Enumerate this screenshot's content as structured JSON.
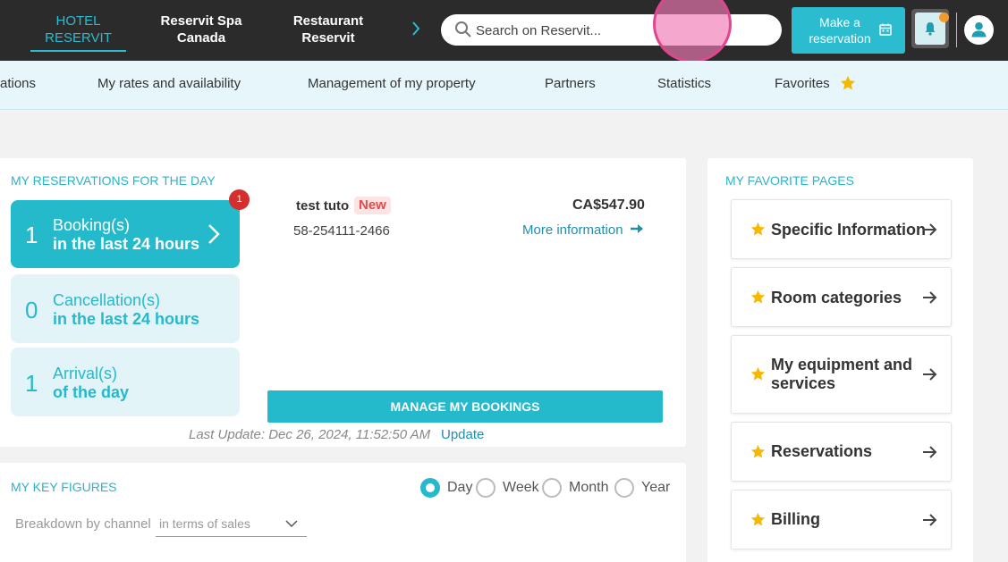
{
  "header": {
    "properties": [
      {
        "line1": "HOTEL",
        "line2": "RESERVIT"
      },
      {
        "line1": "Reservit Spa",
        "line2": "Canada"
      },
      {
        "line1": "Restaurant",
        "line2": "Reservit"
      }
    ],
    "search_placeholder": "Search on Reservit...",
    "make_reservation": {
      "line1": "Make a",
      "line2": "reservation"
    }
  },
  "nav": {
    "items": [
      "ations",
      "My rates and availability",
      "Management of my property",
      "Partners",
      "Statistics",
      "Favorites"
    ]
  },
  "reservations": {
    "title": "MY RESERVATIONS FOR THE DAY",
    "badge": "1",
    "tiles": [
      {
        "count": "1",
        "line1": "Booking(s)",
        "line2": "in the last 24 hours"
      },
      {
        "count": "0",
        "line1": "Cancellation(s)",
        "line2": "in the last 24 hours"
      },
      {
        "count": "1",
        "line1": "Arrival(s)",
        "line2": "of the day"
      }
    ],
    "entry": {
      "name": "test tuto",
      "tag": "New",
      "number": "58-254111-2466",
      "price": "CA$547.90",
      "more_info": "More information"
    },
    "manage_button": "MANAGE MY BOOKINGS",
    "last_update": "Last Update: Dec 26, 2024, 11:52:50 AM",
    "update_link": "Update"
  },
  "key_figures": {
    "title": "MY KEY FIGURES",
    "periods": [
      "Day",
      "Week",
      "Month",
      "Year"
    ],
    "selected_period": "Day",
    "breakdown_label": "Breakdown by channel",
    "breakdown_value": "in terms of sales"
  },
  "favorites": {
    "title": "MY FAVORITE PAGES",
    "items": [
      {
        "line1": "Specific Information",
        "line2": ""
      },
      {
        "line1": "Room categories",
        "line2": ""
      },
      {
        "line1": "My equipment and",
        "line2": "services"
      },
      {
        "line1": "Reservations",
        "line2": ""
      },
      {
        "line1": "Billing",
        "line2": ""
      }
    ]
  },
  "colors": {
    "accent": "#25b9cc",
    "topbar": "#2b2b2b",
    "navbar": "#e6f6fa",
    "star": "#f5b800",
    "badge": "#d32f2f"
  }
}
